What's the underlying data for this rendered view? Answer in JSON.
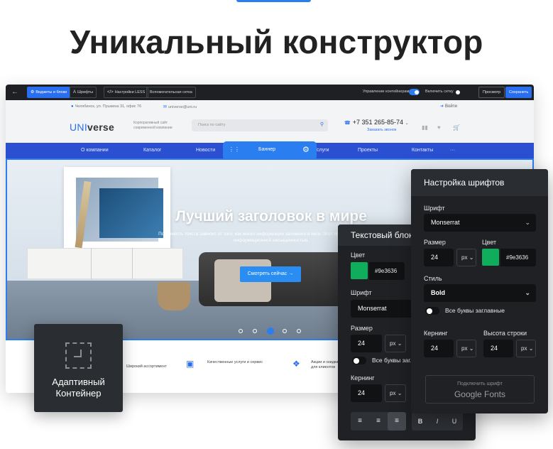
{
  "page": {
    "headline": "Уникальный конструктор"
  },
  "editor_bar": {
    "back_icon": "arrow-left-icon",
    "widgets_label": "Виджеты и блоки",
    "fonts_label": "Шрифты",
    "less_label": "Настройки LESS",
    "grid_label": "Вспомогательная сетка",
    "containers_toggle_label": "Управление контейнерами",
    "containers_toggle_on": true,
    "grid_toggle_label": "Включить сетку",
    "grid_toggle_on": false,
    "preview_label": "Просмотр",
    "save_label": "Сохранить"
  },
  "site": {
    "address": "Челябинск, ул. Пушкина 31, офис 76",
    "email": "universe@uni.ru",
    "login": "Войти",
    "logo_prefix": "UNI",
    "logo_suffix": "verse",
    "tagline": "Корпоративный сайт современной компании",
    "search_placeholder": "Поиск по сайту",
    "phone": "+7 351 265-85-74",
    "callback": "Заказать звонок",
    "nav": [
      "О компании",
      "Каталог",
      "Новости",
      "Услуги",
      "Проекты",
      "Контакты",
      "···"
    ],
    "nav_active_block": "Баннер",
    "banner": {
      "title": "Лучший заголовок в мире",
      "subtitle": "Полезность текста зависит от того, как много информации заложено в него. Этот показатель называется информационной насыщенностью.",
      "cta": "Смотреть сейчас",
      "slides": 5,
      "active_slide": 3
    },
    "features": [
      {
        "icon": "box-icon",
        "text": "Широкий ассортимент"
      },
      {
        "icon": "monitor-icon",
        "text": "Качественные услуги и сервис"
      },
      {
        "icon": "shirt-icon",
        "text": "Акции и скидки для клиентов"
      }
    ]
  },
  "adaptive_card": {
    "label": "Адаптивный Контейнер"
  },
  "text_panel": {
    "title": "Текстовый блок",
    "color_label": "Цвет",
    "color_hex": "#9e3636",
    "swatch_color": "#0fad5c",
    "font_label": "Шрифт",
    "font_value": "Monserrat",
    "size_label": "Размер",
    "size_value": "24",
    "size_unit": "px",
    "uppercase_label": "Все буквы заглавные",
    "kerning_label": "Кернинг",
    "kerning_value": "24",
    "kerning_unit": "px",
    "format_bold": "B",
    "format_italic": "I",
    "format_underline": "U"
  },
  "font_panel": {
    "title": "Настройка шрифтов",
    "font_label": "Шрифт",
    "font_value": "Monserrat",
    "size_label": "Размер",
    "size_value": "24",
    "size_unit": "px",
    "color_label": "Цвет",
    "color_hex": "#9e3636",
    "swatch_color": "#0fad5c",
    "style_label": "Стиль",
    "style_value": "Bold",
    "uppercase_label": "Все буквы заглавные",
    "kerning_label": "Кернинг",
    "kerning_value": "24",
    "kerning_unit": "px",
    "line_height_label": "Высота строки",
    "line_height_value": "24",
    "line_height_unit": "px",
    "google_fonts_top": "Подключить шрифт",
    "google_fonts_bottom": "Google Fonts"
  },
  "colors": {
    "accent": "#2a7ef0",
    "nav": "#2a4fd0",
    "panel": "#1f2125",
    "swatch": "#0fad5c"
  }
}
